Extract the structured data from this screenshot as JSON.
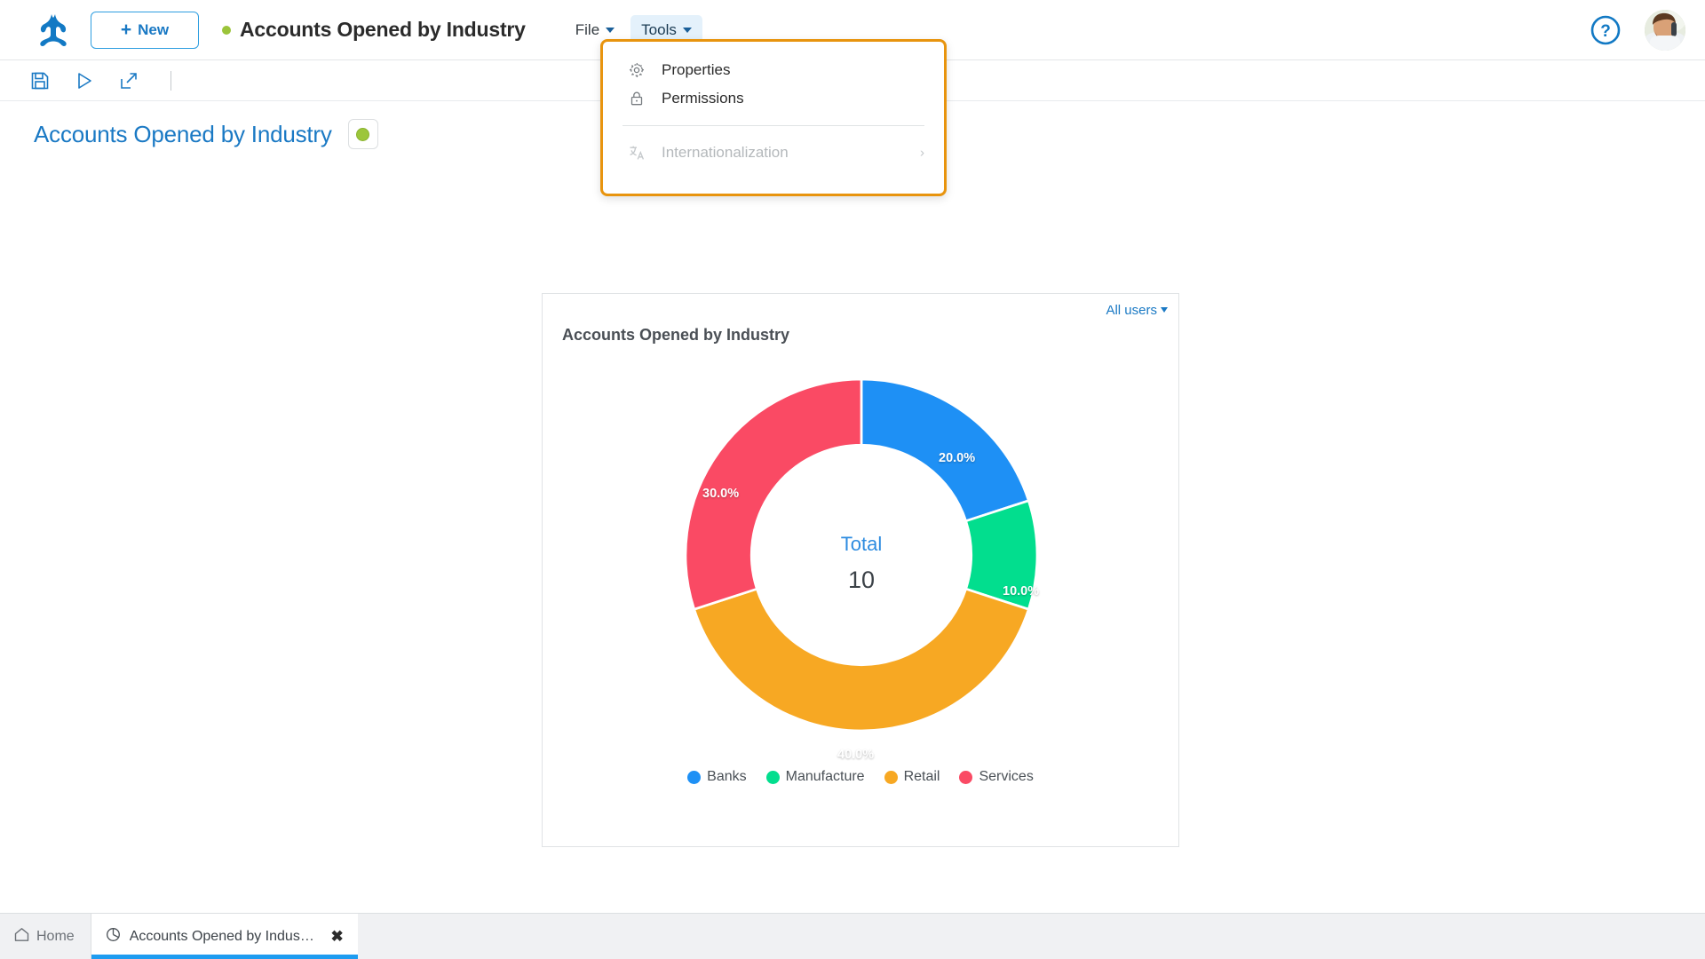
{
  "topbar": {
    "logo_name": "frog-logo",
    "new_button_label": "New",
    "new_button_plus": "+",
    "document_title": "Accounts Opened by Industry",
    "status_dot_color": "#9bc43a",
    "menus": [
      {
        "label": "File",
        "active": false
      },
      {
        "label": "Tools",
        "active": true
      }
    ],
    "help_label": "?",
    "avatar_name": "user-avatar"
  },
  "toolbar": {
    "save_label": "Save",
    "run_label": "Run",
    "export_label": "Export"
  },
  "dropdown": {
    "open_menu": "Tools",
    "highlight_color": "#e8940e",
    "items": [
      {
        "label": "Properties",
        "icon": "gear-icon",
        "disabled": false,
        "submenu": false
      },
      {
        "label": "Permissions",
        "icon": "lock-icon",
        "disabled": false,
        "submenu": false
      },
      {
        "label": "Internationalization",
        "icon": "translate-icon",
        "disabled": true,
        "submenu": true
      }
    ],
    "submenu_chevron": "›"
  },
  "page": {
    "title": "Accounts Opened by Industry",
    "status_badge_color": "#9cc63b"
  },
  "card": {
    "filter_label": "All users",
    "title": "Accounts Opened by Industry",
    "center_label": "Total",
    "center_value": "10"
  },
  "chart_data": {
    "type": "pie",
    "variant": "donut",
    "title": "Accounts Opened by Industry",
    "categories": [
      "Banks",
      "Manufacture",
      "Retail",
      "Services"
    ],
    "values": [
      2,
      1,
      4,
      3
    ],
    "percent_labels": [
      "20.0%",
      "10.0%",
      "40.0%",
      "30.0%"
    ],
    "percentages": [
      20.0,
      10.0,
      40.0,
      30.0
    ],
    "colors": [
      "#1e90f5",
      "#02de8e",
      "#f7a823",
      "#fa4a64"
    ],
    "total": 10,
    "total_label": "Total",
    "legend_position": "bottom",
    "start_angle_deg": 0,
    "grid": false,
    "xlabel": "",
    "ylabel": ""
  },
  "taskbar": {
    "home_label": "Home",
    "tabs": [
      {
        "label": "Accounts Opened by Industry (MyA…)",
        "icon": "pie-chart-icon",
        "active": true,
        "close": "✖"
      }
    ]
  }
}
